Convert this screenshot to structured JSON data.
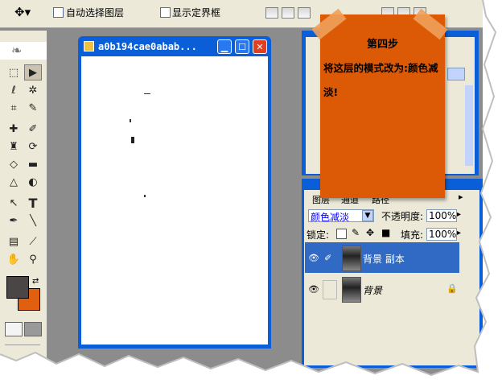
{
  "options_bar": {
    "auto_select_layer": "自动选择图层",
    "show_bounding_box": "显示定界框"
  },
  "document": {
    "title": "a0b194cae0abab..."
  },
  "layers_panel": {
    "tabs": [
      "图层",
      "通道",
      "路径"
    ],
    "blend_mode": "颜色减淡",
    "opacity_label": "不透明度:",
    "opacity_value": "100%",
    "lock_label": "锁定:",
    "fill_label": "填充:",
    "fill_value": "100%",
    "layers": [
      {
        "name": "背景 副本",
        "selected": true
      },
      {
        "name": "背景",
        "selected": false,
        "locked": true
      }
    ]
  },
  "note": {
    "heading": "第四步",
    "text": "将这层的模式改为:颜色减淡!"
  },
  "colors": {
    "foreground": "#4a4646",
    "background": "#e06010",
    "note": "#dc5a06",
    "title_bar": "#0a5ed8"
  },
  "icons": [
    "move-tool-icon",
    "marquee-tool-icon",
    "lasso-tool-icon",
    "magic-wand-icon",
    "crop-tool-icon",
    "slice-tool-icon",
    "healing-brush-icon",
    "brush-tool-icon",
    "clone-stamp-icon",
    "history-brush-icon",
    "eraser-icon",
    "gradient-icon",
    "blur-icon",
    "dodge-icon",
    "path-select-icon",
    "text-tool-icon",
    "pen-tool-icon",
    "line-tool-icon",
    "notes-icon",
    "eyedropper-icon",
    "hand-tool-icon",
    "zoom-tool-icon",
    "eye-icon",
    "brush-link-icon",
    "lock-icon"
  ]
}
